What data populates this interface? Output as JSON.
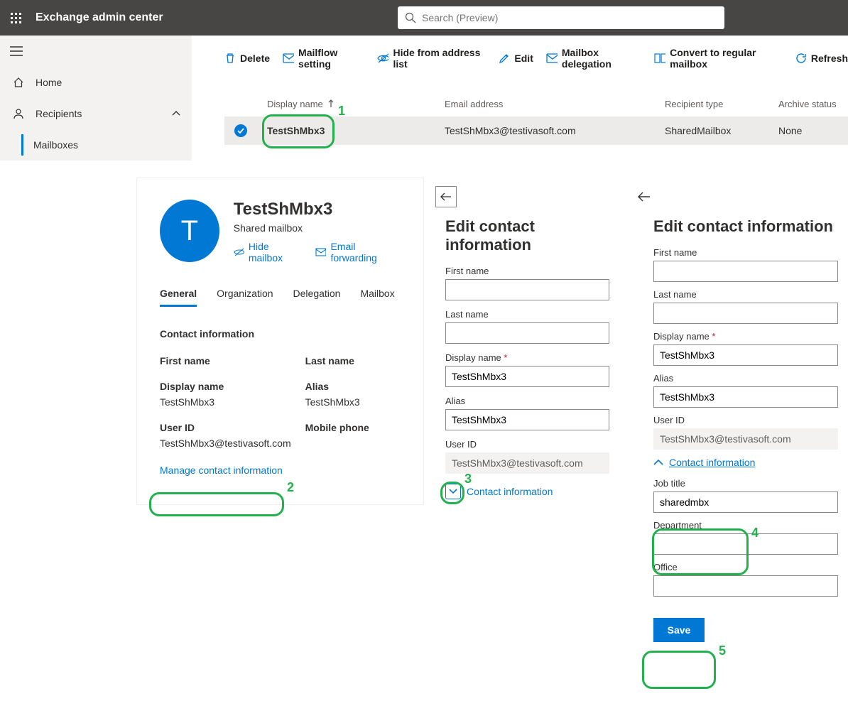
{
  "app_title": "Exchange admin center",
  "search_placeholder": "Search (Preview)",
  "nav": {
    "home": "Home",
    "recipients": "Recipients",
    "mailboxes": "Mailboxes"
  },
  "toolbar": {
    "delete": "Delete",
    "mailflow": "Mailflow setting",
    "hide": "Hide from address list",
    "edit": "Edit",
    "delegation": "Mailbox delegation",
    "convert": "Convert to regular mailbox",
    "refresh": "Refresh"
  },
  "table": {
    "headers": {
      "display_name": "Display name",
      "email": "Email address",
      "recipient": "Recipient type",
      "archive": "Archive status"
    },
    "row": {
      "display_name": "TestShMbx3",
      "email": "TestShMbx3@testivasoft.com",
      "recipient": "SharedMailbox",
      "archive": "None"
    }
  },
  "details": {
    "avatar_letter": "T",
    "title": "TestShMbx3",
    "subtitle": "Shared mailbox",
    "hide": "Hide mailbox",
    "forward": "Email forwarding",
    "tabs": {
      "general": "General",
      "org": "Organization",
      "del": "Delegation",
      "mbx": "Mailbox"
    },
    "section": "Contact information",
    "fields": {
      "first_name_l": "First name",
      "last_name_l": "Last name",
      "display_name_l": "Display name",
      "display_name_v": "TestShMbx3",
      "alias_l": "Alias",
      "alias_v": "TestShMbx3",
      "user_id_l": "User ID",
      "user_id_v": "TestShMbx3@testivasoft.com",
      "mobile_l": "Mobile phone"
    },
    "manage_link": "Manage contact information"
  },
  "edit1": {
    "title": "Edit contact information",
    "first_name": "First name",
    "last_name": "Last name",
    "display_name": "Display name",
    "display_name_v": "TestShMbx3",
    "alias": "Alias",
    "alias_v": "TestShMbx3",
    "user_id": "User ID",
    "user_id_v": "TestShMbx3@testivasoft.com",
    "contact_info": "Contact information"
  },
  "edit2": {
    "title": "Edit contact information",
    "first_name": "First name",
    "last_name": "Last name",
    "display_name": "Display name",
    "display_name_v": "TestShMbx3",
    "alias": "Alias",
    "alias_v": "TestShMbx3",
    "user_id": "User ID",
    "user_id_v": "TestShMbx3@testivasoft.com",
    "contact_info": "Contact information",
    "job_title": "Job title",
    "job_title_v": "sharedmbx",
    "department": "Department",
    "office": "Office",
    "save": "Save"
  },
  "annotations": {
    "1": "1",
    "2": "2",
    "3": "3",
    "4": "4",
    "5": "5"
  }
}
